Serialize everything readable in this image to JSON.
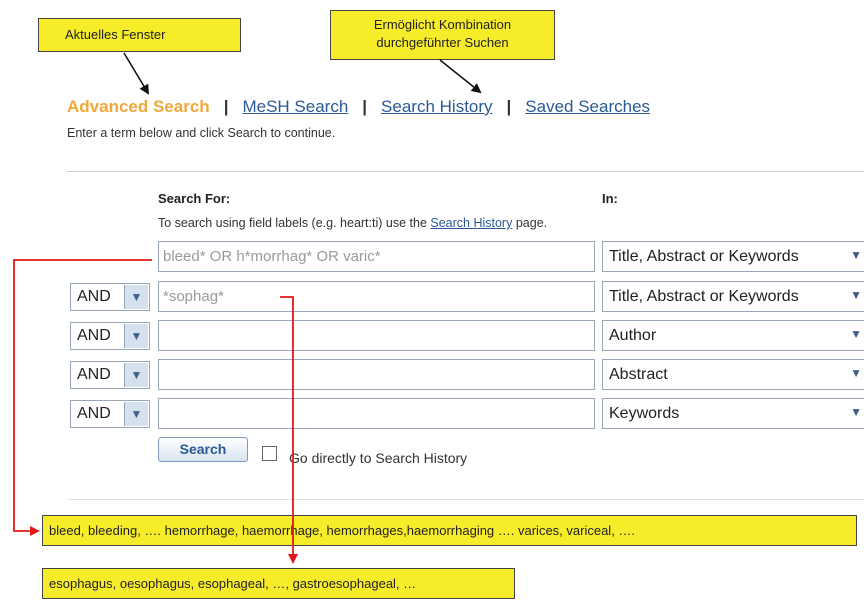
{
  "callouts": {
    "window": "Aktuelles Fenster",
    "combo_line1": "Ermöglicht Kombination",
    "combo_line2": "durchgeführter Suchen"
  },
  "nav": {
    "active": "Advanced Search",
    "separator": "|",
    "mesh": "MeSH Search",
    "history": "Search History",
    "saved": "Saved Searches"
  },
  "hint": "Enter a term below and click Search to continue.",
  "form": {
    "search_for_label": "Search For:",
    "in_label": "In:",
    "tip_before": "To search using field labels (e.g. heart:ti) use the ",
    "tip_link": "Search History",
    "tip_after": " page.",
    "rows": [
      {
        "operator": "",
        "term": "bleed* OR h*morrhag* OR varic*",
        "field": "Title, Abstract or Keywords"
      },
      {
        "operator": "AND",
        "term": "*sophag*",
        "field": "Title, Abstract or Keywords"
      },
      {
        "operator": "AND",
        "term": "",
        "field": "Author"
      },
      {
        "operator": "AND",
        "term": "",
        "field": "Abstract"
      },
      {
        "operator": "AND",
        "term": "",
        "field": "Keywords"
      }
    ],
    "search_button": "Search",
    "go_history_label": "Go directly to Search History",
    "dropdown_arrow": "▼"
  },
  "annotations": {
    "bleed_terms": "bleed, bleeding, …. hemorrhage, haemorrhage, hemorrhages,haemorrhaging …. varices, variceal, ….",
    "sophag_terms": "esophagus, oesophagus, esophageal, …, gastroesophageal, …"
  },
  "colors": {
    "highlight_yellow": "#f7ec2a",
    "active_tab_orange": "#f0a838",
    "link_blue": "#2a5a96",
    "connector_red": "#e01818"
  }
}
